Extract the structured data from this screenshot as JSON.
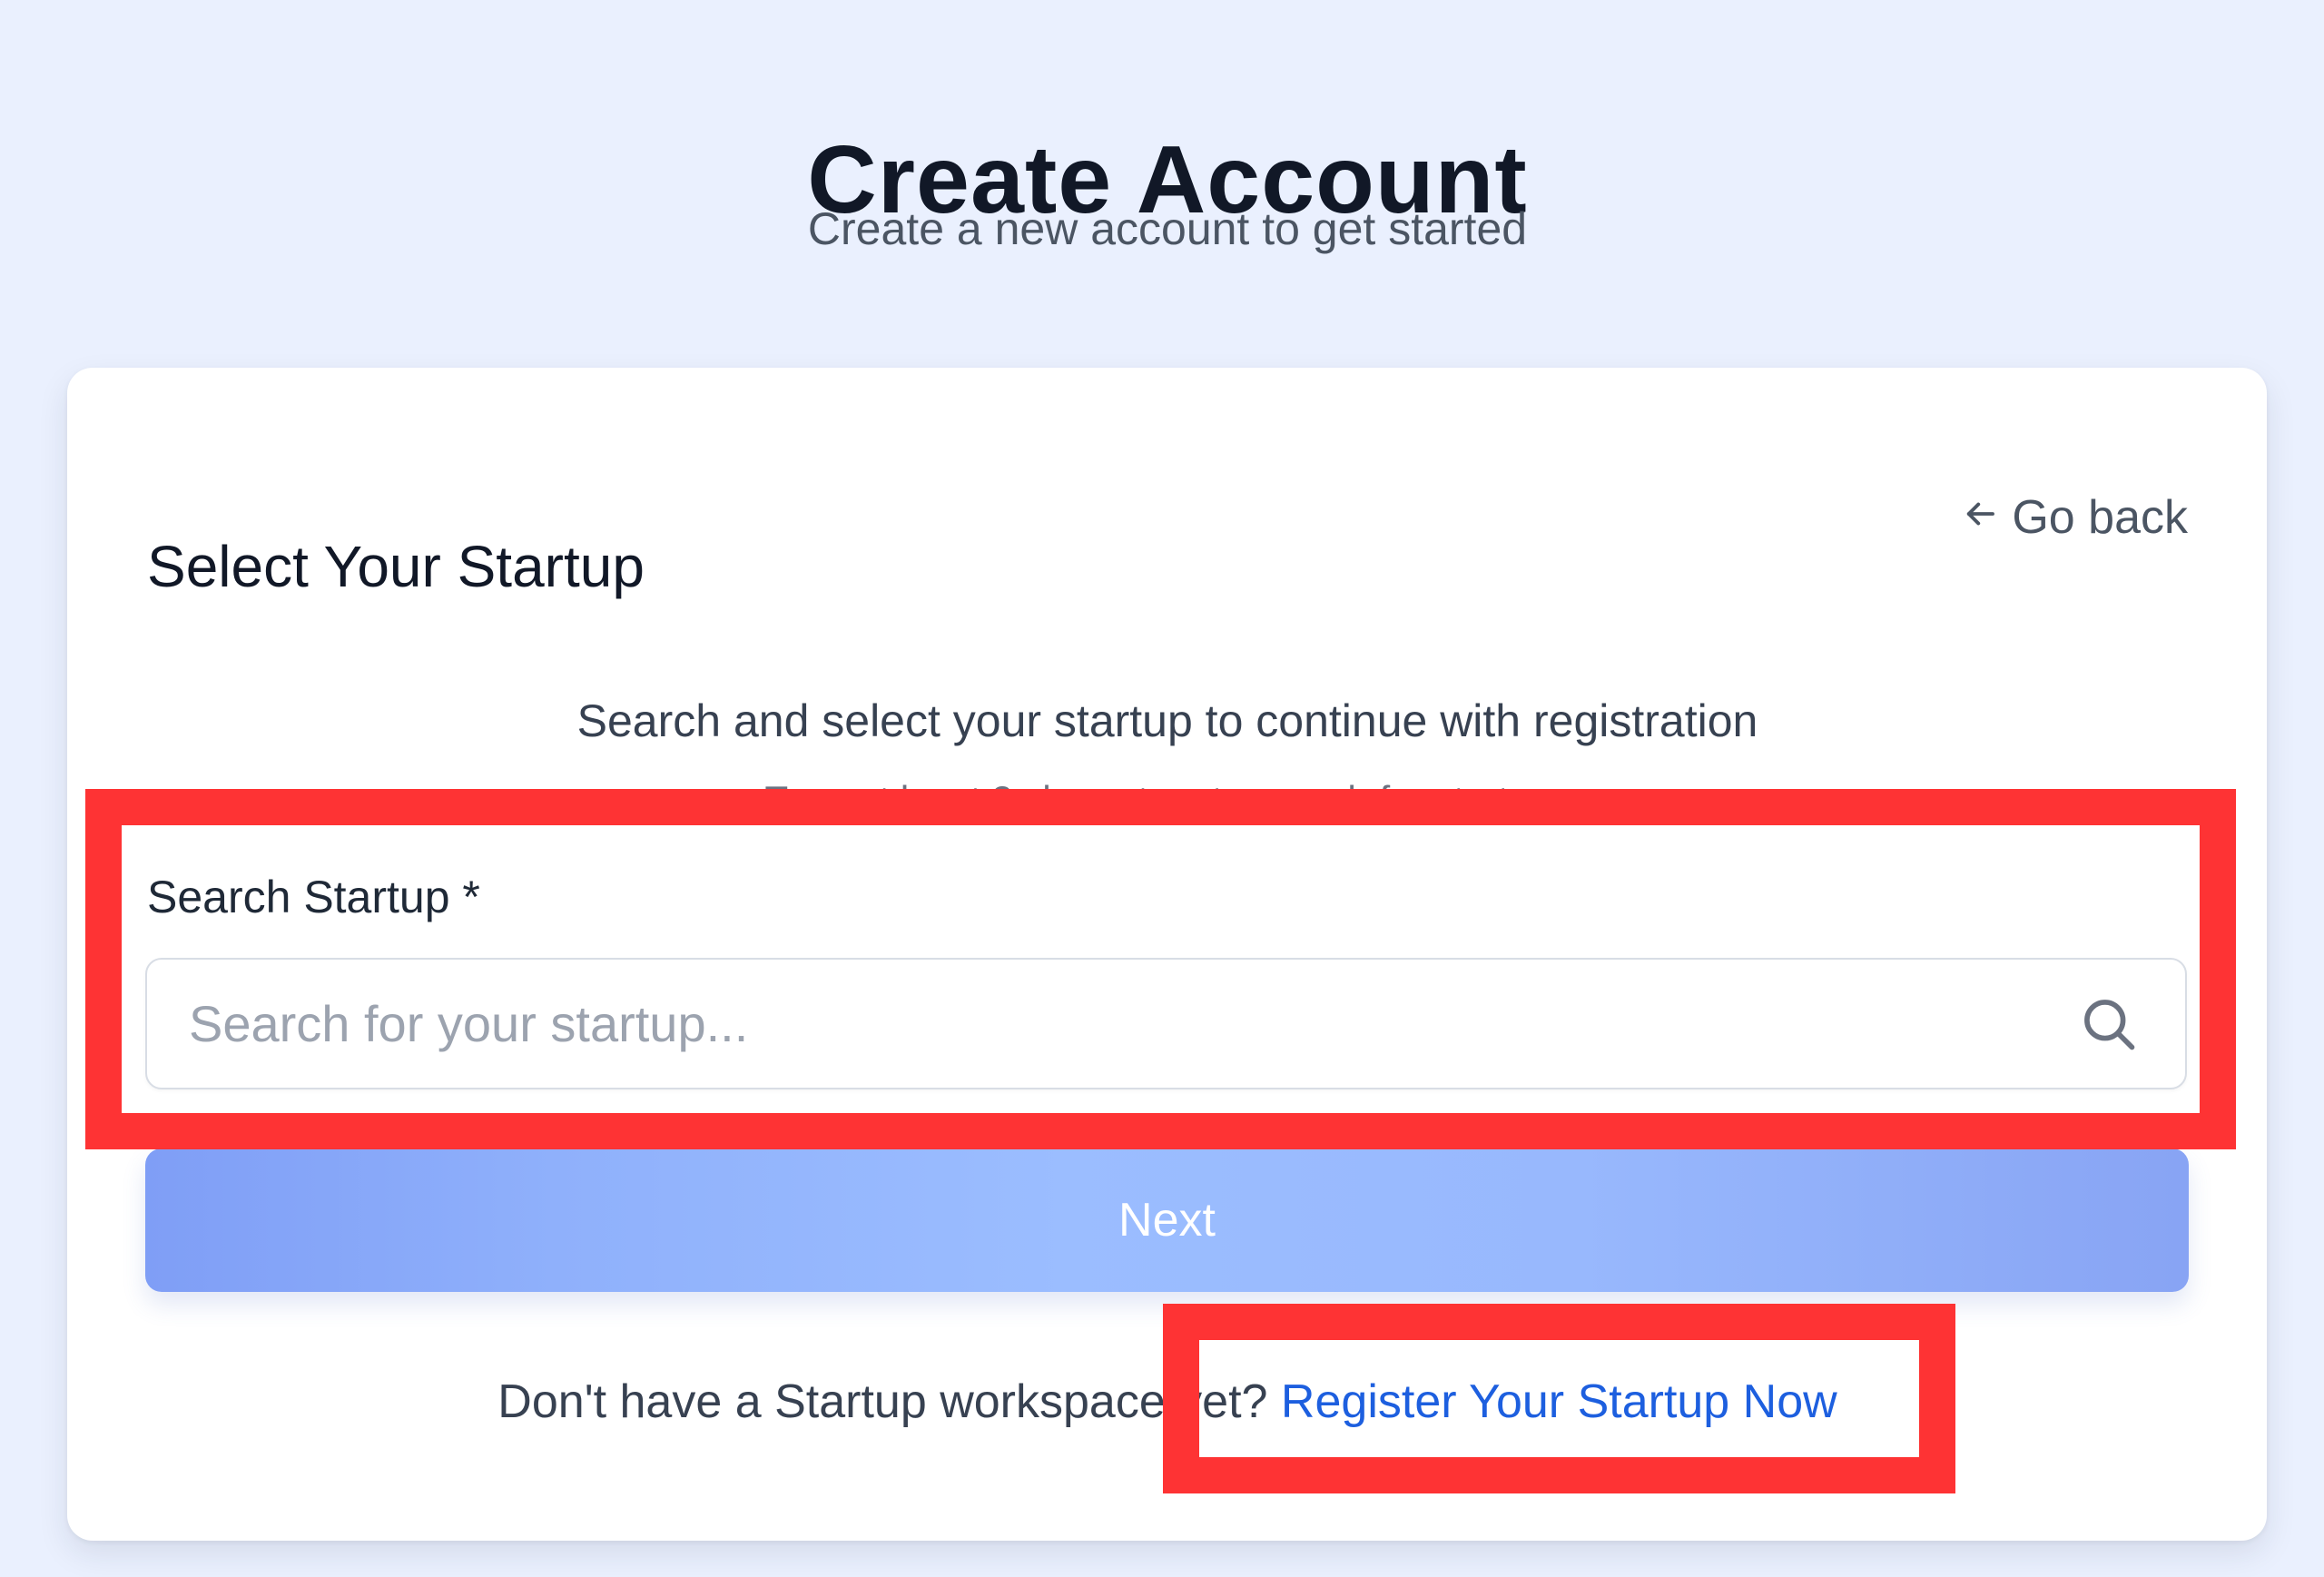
{
  "header": {
    "title": "Create Account",
    "subtitle": "Create a new account to get started"
  },
  "card": {
    "title": "Select Your Startup",
    "go_back_label": "Go back",
    "instructions": "Search and select your startup to continue with registration",
    "hint": "Type at least 2 characters to search for startups",
    "search": {
      "label": "Search Startup *",
      "placeholder": "Search for your startup...",
      "value": ""
    },
    "next_button_label": "Next",
    "register": {
      "prompt": "Don't have a Startup workspace yet? ",
      "link_label": "Register Your Startup Now"
    }
  },
  "icons": {
    "go_back": "arrow-left-icon",
    "search": "search-icon"
  },
  "colors": {
    "background": "#eaf0fe",
    "card": "#ffffff",
    "link": "#1d5fdf",
    "button": "#9bbdff",
    "highlight": "#fe3334"
  }
}
